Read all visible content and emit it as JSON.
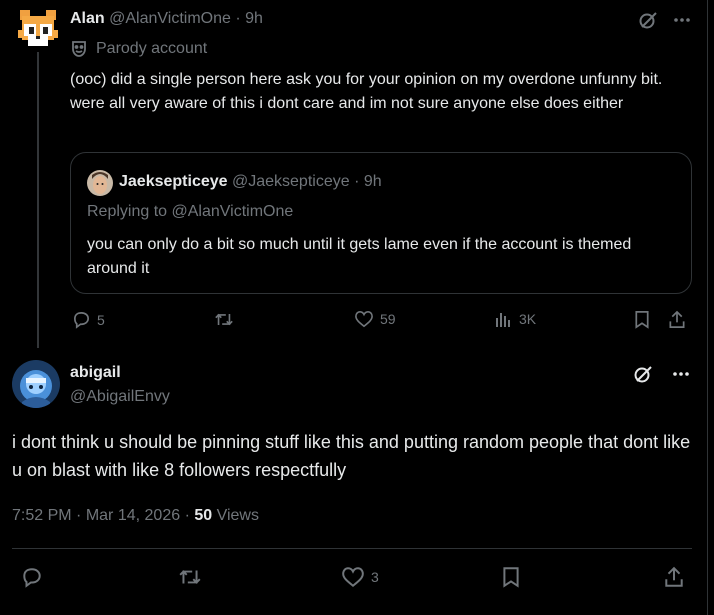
{
  "tweet1": {
    "name": "Alan",
    "handle": "@AlanVictimOne",
    "separator": "·",
    "time": "9h",
    "label": "Parody account",
    "body": "(ooc) did a single person here ask you for your opinion on my overdone unfunny bit. were all very aware of this i dont care and im not sure anyone else does either",
    "quote": {
      "name": "Jaeksepticeye",
      "handle": "@Jaeksepticeye",
      "separator": "·",
      "time": "9h",
      "replying": "Replying to @AlanVictimOne",
      "body": "you can only do a bit so much until it gets lame even if the account is themed around it"
    },
    "actions": {
      "replies": "5",
      "retweets": "",
      "likes": "59",
      "views": "3K"
    }
  },
  "tweet2": {
    "name": "abigail",
    "handle": "@AbigailEnvy",
    "body": "i dont think u should be pinning stuff like this and putting random people that dont like u on blast with like 8 followers respectfully",
    "time": "7:52 PM",
    "date": "Mar 14, 2026",
    "separator": "·",
    "views_count": "50",
    "views_label": "Views",
    "actions": {
      "likes": "3"
    }
  },
  "colors": {
    "background": "#000000",
    "text": "#e7e9ea",
    "muted": "#71767b",
    "border": "#2f3336"
  }
}
